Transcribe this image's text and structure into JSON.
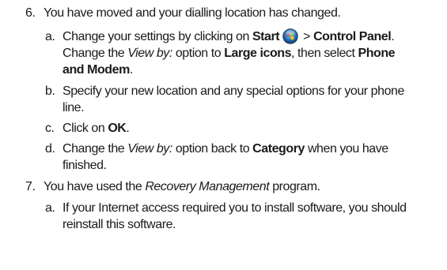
{
  "items": [
    {
      "number": "6.",
      "text": "You have moved and your dialling location has changed.",
      "subitems": [
        {
          "letter": "a.",
          "l1_pre": "Change your settings by clicking on",
          "l1_start": "Start",
          "l1_gt": ">",
          "l1_cp": "Control Panel",
          "l1_end": ".",
          "l2_pre": "Change the",
          "l2_viewby": "View by:",
          "l2_mid": "option to",
          "l2_large": "Large icons",
          "l2_post": ", then select",
          "l2_phone": "Phone",
          "l3_modem": "and Modem",
          "l3_end": "."
        },
        {
          "letter": "b.",
          "l1": "Specify your new location and any special options for your phone",
          "l2": "line."
        },
        {
          "letter": "c.",
          "pre": "Click on",
          "ok": "OK",
          "end": "."
        },
        {
          "letter": "d.",
          "l1_pre": "Change the",
          "l1_viewby": "View by:",
          "l1_mid": "option back to",
          "l1_category": "Category",
          "l1_post": "when you have",
          "l2": "finished."
        }
      ]
    },
    {
      "number": "7.",
      "text_pre": "You have used the",
      "text_italic": "Recovery Management",
      "text_post": "program.",
      "subitems": [
        {
          "letter": "a.",
          "l1": "If your Internet access required you to install software, you should",
          "l2": "reinstall this software."
        }
      ]
    }
  ],
  "icons": {
    "start_orb": "windows-start-orb-icon"
  }
}
